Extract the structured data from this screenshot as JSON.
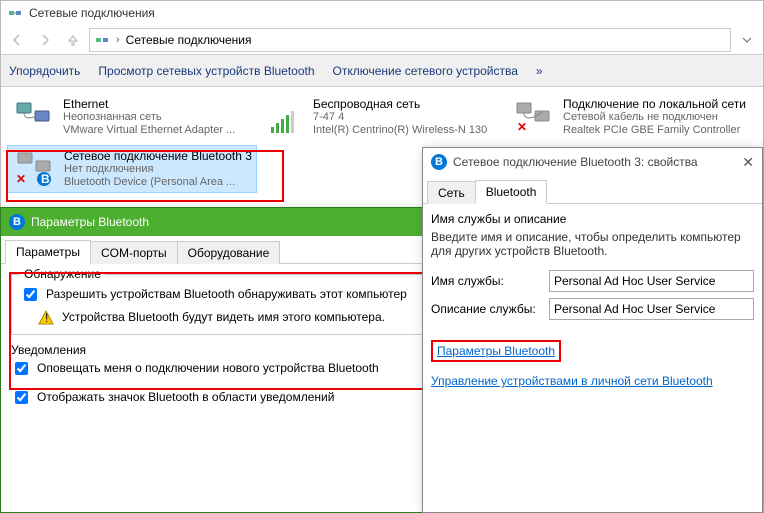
{
  "window": {
    "title": "Сетевые подключения",
    "breadcrumb": "Сетевые подключения"
  },
  "toolbar": {
    "organize": "Упорядочить",
    "view_bt_devices": "Просмотр сетевых устройств Bluetooth",
    "disable_device": "Отключение сетевого устройства",
    "more": "»"
  },
  "connections": [
    {
      "name": "Ethernet",
      "status": "Неопознанная сеть",
      "device": "VMware Virtual Ethernet Adapter ..."
    },
    {
      "name": "Беспроводная сеть",
      "status": "7-47  4",
      "device": "Intel(R) Centrino(R) Wireless-N 130"
    },
    {
      "name": "Подключение по локальной сети",
      "status": "Сетевой кабель не подключен",
      "device": "Realtek PCIe GBE Family Controller"
    },
    {
      "name": "Сетевое подключение Bluetooth 3",
      "status": "Нет подключения",
      "device": "Bluetooth Device (Personal Area ..."
    }
  ],
  "bt_settings": {
    "title": "Параметры Bluetooth",
    "tabs": {
      "params": "Параметры",
      "com": "COM-порты",
      "hardware": "Оборудование"
    },
    "discovery_group": "Обнаружение",
    "allow_discover": "Разрешить устройствам Bluetooth обнаруживать этот компьютер",
    "warning": "Устройства Bluetooth будут видеть имя этого компьютера.",
    "notifications_group": "Уведомления",
    "notify_new": "Оповещать меня о подключении нового устройства Bluetooth",
    "show_tray": "Отображать значок Bluetooth в области уведомлений"
  },
  "properties": {
    "title": "Сетевое подключение Bluetooth 3: свойства",
    "tabs": {
      "network": "Сеть",
      "bluetooth": "Bluetooth"
    },
    "section_title": "Имя службы и описание",
    "section_desc": "Введите имя и описание, чтобы определить компьютер для других устройств Bluetooth.",
    "service_name_label": "Имя службы:",
    "service_name_value": "Personal Ad Hoc User Service",
    "service_desc_label": "Описание службы:",
    "service_desc_value": "Personal Ad Hoc User Service",
    "link_params": "Параметры Bluetooth",
    "link_manage": "Управление устройствами в личной сети Bluetooth"
  }
}
